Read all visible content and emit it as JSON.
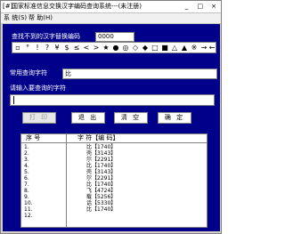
{
  "window": {
    "title": "国家标准信息交换汉字编码查询系统---(未注册)",
    "icon": "[#]",
    "controls": [
      "_",
      "□",
      "×"
    ]
  },
  "menu": [
    {
      "label": "系 统(S)"
    },
    {
      "label": "帮 助(H)"
    }
  ],
  "lookup": {
    "label": "查找不到的汉字替换编码",
    "value": "0000"
  },
  "symbols": [
    "▫",
    "°",
    "!",
    "?",
    "¥",
    "$",
    "≤",
    "<",
    ">",
    "★",
    "●",
    "◎",
    "◇",
    "◆",
    "□",
    "■",
    "△",
    "▲",
    "※",
    "→",
    "←"
  ],
  "common": {
    "label": "常用查询字符",
    "value": "比"
  },
  "query": {
    "label": "请输入要查询的字符",
    "value": ""
  },
  "buttons": {
    "print": "打 印",
    "exit": "退 出",
    "clear": "清 空",
    "ok": "确 定"
  },
  "table": {
    "headers": [
      "序 号",
      "字 符【编 码】"
    ],
    "rows": [
      {
        "no": "1.",
        "value": "比【1740】"
      },
      {
        "no": "2.",
        "value": "壳【3143】"
      },
      {
        "no": "3.",
        "value": "尔【2291】"
      },
      {
        "no": "4.",
        "value": "比【1740】"
      },
      {
        "no": "5.",
        "value": "壳【3143】"
      },
      {
        "no": "6.",
        "value": "尔【2291】"
      },
      {
        "no": "7.",
        "value": "比【1740】"
      },
      {
        "no": "8.",
        "value": "飞【4724】"
      },
      {
        "no": "9.",
        "value": "载【5256】"
      },
      {
        "no": "10.",
        "value": "话【5330】"
      },
      {
        "no": "11.",
        "value": "比【1740】"
      },
      {
        "no": "12.",
        "value": ""
      }
    ]
  }
}
